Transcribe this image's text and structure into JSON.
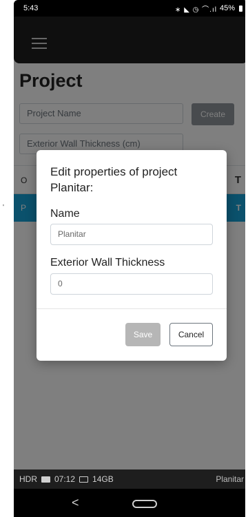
{
  "status_bar": {
    "time": "5:43",
    "icons_text": "∗ ◣ ◷ ⌒.ıl",
    "battery": "45%"
  },
  "app_bar": {
    "menu_icon": "hamburger-icon"
  },
  "page": {
    "title": "Project",
    "project_name_placeholder": "Project Name",
    "create_label": "Create",
    "wall_thickness_placeholder": "Exterior Wall Thickness (cm)",
    "table": {
      "head_cell": "O",
      "head_tail": "T",
      "row_cell": "P",
      "row_tail": "T"
    }
  },
  "modal": {
    "title": "Edit properties of project Planitar:",
    "name_label": "Name",
    "name_value": "Planitar",
    "thickness_label": "Exterior Wall Thickness",
    "thickness_value": "0",
    "save_label": "Save",
    "cancel_label": "Cancel"
  },
  "taskbar": {
    "hdr": "HDR",
    "time": "07:12",
    "storage": "14GB",
    "app_name": "Planitar"
  },
  "nav_bar": {
    "back_glyph": "<"
  }
}
